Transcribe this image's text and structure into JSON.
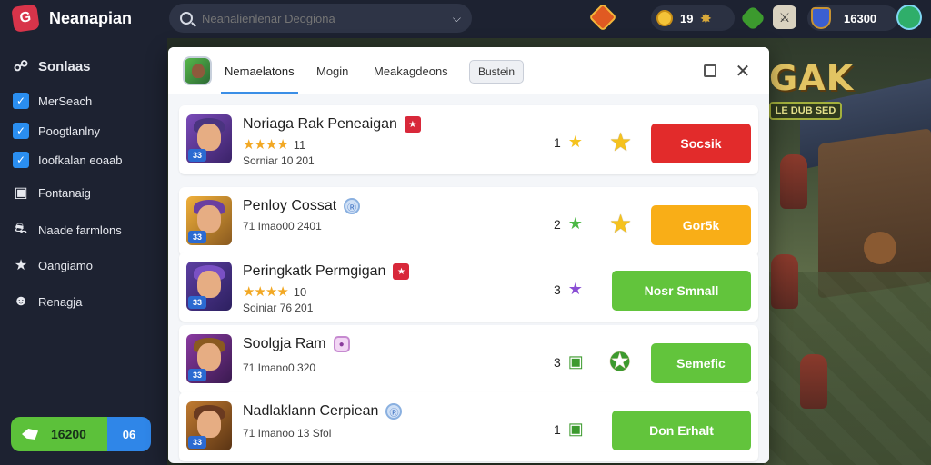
{
  "app": {
    "name": "Neanapian",
    "logo_glyph": "G"
  },
  "search": {
    "placeholder": "Neanalienlenar Deogiona"
  },
  "topbar": {
    "coins": "19",
    "balance": "16300"
  },
  "sidebar": {
    "items": [
      {
        "label": "Sonlaas",
        "icon": "user-icon"
      },
      {
        "label": "MerSeach",
        "icon": "check-icon"
      },
      {
        "label": "Poogtlanlny",
        "icon": "check-icon"
      },
      {
        "label": "Ioofkalan eoaab",
        "icon": "check-icon"
      },
      {
        "label": "Fontanaig",
        "icon": "camera-icon"
      },
      {
        "label": "Naade farmlons",
        "icon": "car-icon"
      },
      {
        "label": "Oangiamo",
        "icon": "star-icon"
      },
      {
        "label": "Renagja",
        "icon": "profile-icon"
      }
    ],
    "wallet": {
      "amount": "16200",
      "extra": "06"
    }
  },
  "game": {
    "logo": "GAK",
    "sub": "LE DUB SED"
  },
  "modal": {
    "tabs": [
      "Nemaelatons",
      "Mogin",
      "Meakagdeons"
    ],
    "button": "Bustein",
    "rows": [
      {
        "name": "Noriaga Rak Peneaigan",
        "rating": "11",
        "sub": "Sorniar 10 201",
        "rank": "1",
        "action": "Socsik",
        "action_color": "#e22b2b",
        "stars": 4,
        "rank_color": "#f5c21e"
      },
      {
        "name": "Penloy Cossat",
        "rating": "",
        "sub": "71 Imao00 2401",
        "rank": "2",
        "action": "Gor5k",
        "action_color": "#f9ae17",
        "stars": 0,
        "rank_color": "#4cb846"
      },
      {
        "name": "Peringkatk Permgigan",
        "rating": "10",
        "sub": "Soiniar 76 201",
        "rank": "3",
        "action": "Nosr Smnall",
        "action_color": "#62c43c",
        "stars": 4,
        "rank_color": "#8a4ed4"
      },
      {
        "name": "Soolgja Ram",
        "rating": "",
        "sub": "71 Imano0 320",
        "rank": "3",
        "action": "Semefic",
        "action_color": "#62c43c",
        "stars": 0,
        "rank_color": "#3c9a2e"
      },
      {
        "name": "Nadlaklann Cerpiean",
        "rating": "",
        "sub": "71 Imanoo 13 Sfol",
        "rank": "1",
        "action": "Don Erhalt",
        "action_color": "#62c43c",
        "stars": 0,
        "rank_color": "#3c9a2e"
      }
    ]
  }
}
